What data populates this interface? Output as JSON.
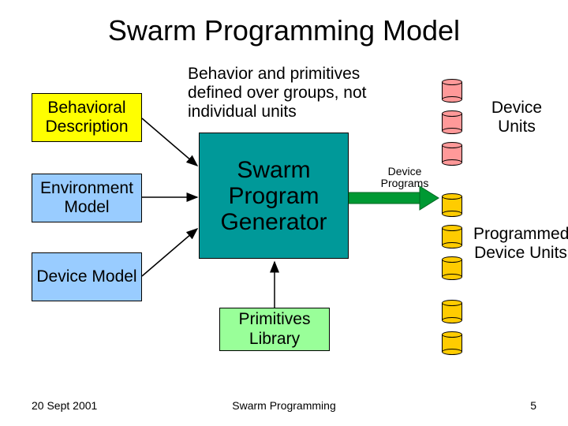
{
  "title": "Swarm Programming Model",
  "caption": "Behavior and primitives defined over groups, not individual units",
  "boxes": {
    "behavioral": "Behavioral Description",
    "environment": "Environment Model",
    "device": "Device Model",
    "generator": "Swarm Program Generator",
    "primitives": "Primitives Library"
  },
  "labels": {
    "device_units": "Device Units",
    "programmed_device_units": "Programmed Device Units",
    "device_programs": "Device Programs"
  },
  "footer": {
    "date": "20 Sept 2001",
    "center": "Swarm Programming",
    "page": "5"
  }
}
